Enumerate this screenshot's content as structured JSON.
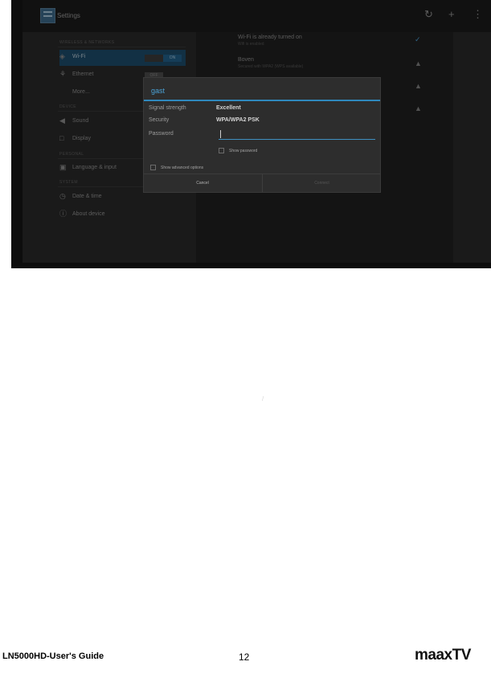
{
  "app": {
    "title": "Settings"
  },
  "header": {
    "actions": [
      {
        "name": "refresh-icon",
        "glyph": "↻"
      },
      {
        "name": "add-icon",
        "glyph": "+"
      },
      {
        "name": "more-icon",
        "glyph": "⋮"
      }
    ]
  },
  "sidebar": {
    "sections": [
      {
        "title": "WIRELESS & NETWORKS"
      },
      {
        "title": "DEVICE"
      },
      {
        "title": "PERSONAL"
      },
      {
        "title": "SYSTEM"
      }
    ],
    "items": [
      {
        "label": "Wi-Fi",
        "toggle_state": "ON",
        "icon": "◈",
        "icon_name": "wifi-icon"
      },
      {
        "label": "Ethernet",
        "toggle_state": "OFF",
        "icon": "⚘",
        "icon_name": "ethernet-icon"
      },
      {
        "label": "More...",
        "icon": "",
        "icon_name": "more-item-icon"
      },
      {
        "label": "Sound",
        "icon": "◀",
        "icon_name": "speaker-icon"
      },
      {
        "label": "Display",
        "icon": "□",
        "icon_name": "display-icon"
      },
      {
        "label": "Language & input",
        "icon": "▣",
        "icon_name": "language-icon"
      },
      {
        "label": "Date & time",
        "icon": "◷",
        "icon_name": "clock-icon"
      },
      {
        "label": "About device",
        "icon": "ⓘ",
        "icon_name": "info-icon"
      }
    ]
  },
  "networks": [
    {
      "title": "Wi-Fi is already turned on",
      "subtitle": "Wifi is enabled",
      "icon": "✓"
    },
    {
      "title": "Boven",
      "subtitle": "Secured with WPA2 (WPS available)",
      "icon": "▲"
    }
  ],
  "dialog": {
    "title": "gast",
    "fields": {
      "signal_label": "Signal strength",
      "signal_value": "Excellent",
      "security_label": "Security",
      "security_value": "WPA/WPA2 PSK",
      "password_label": "Password",
      "password_value": ""
    },
    "show_password_label": "Show password",
    "advanced_label": "Show advanced options",
    "buttons": {
      "cancel": "Cancel",
      "connect": "Connect"
    }
  },
  "footer": {
    "guide": "LN5000HD-User's Guide",
    "page": "12",
    "brand": "maaxTV"
  }
}
